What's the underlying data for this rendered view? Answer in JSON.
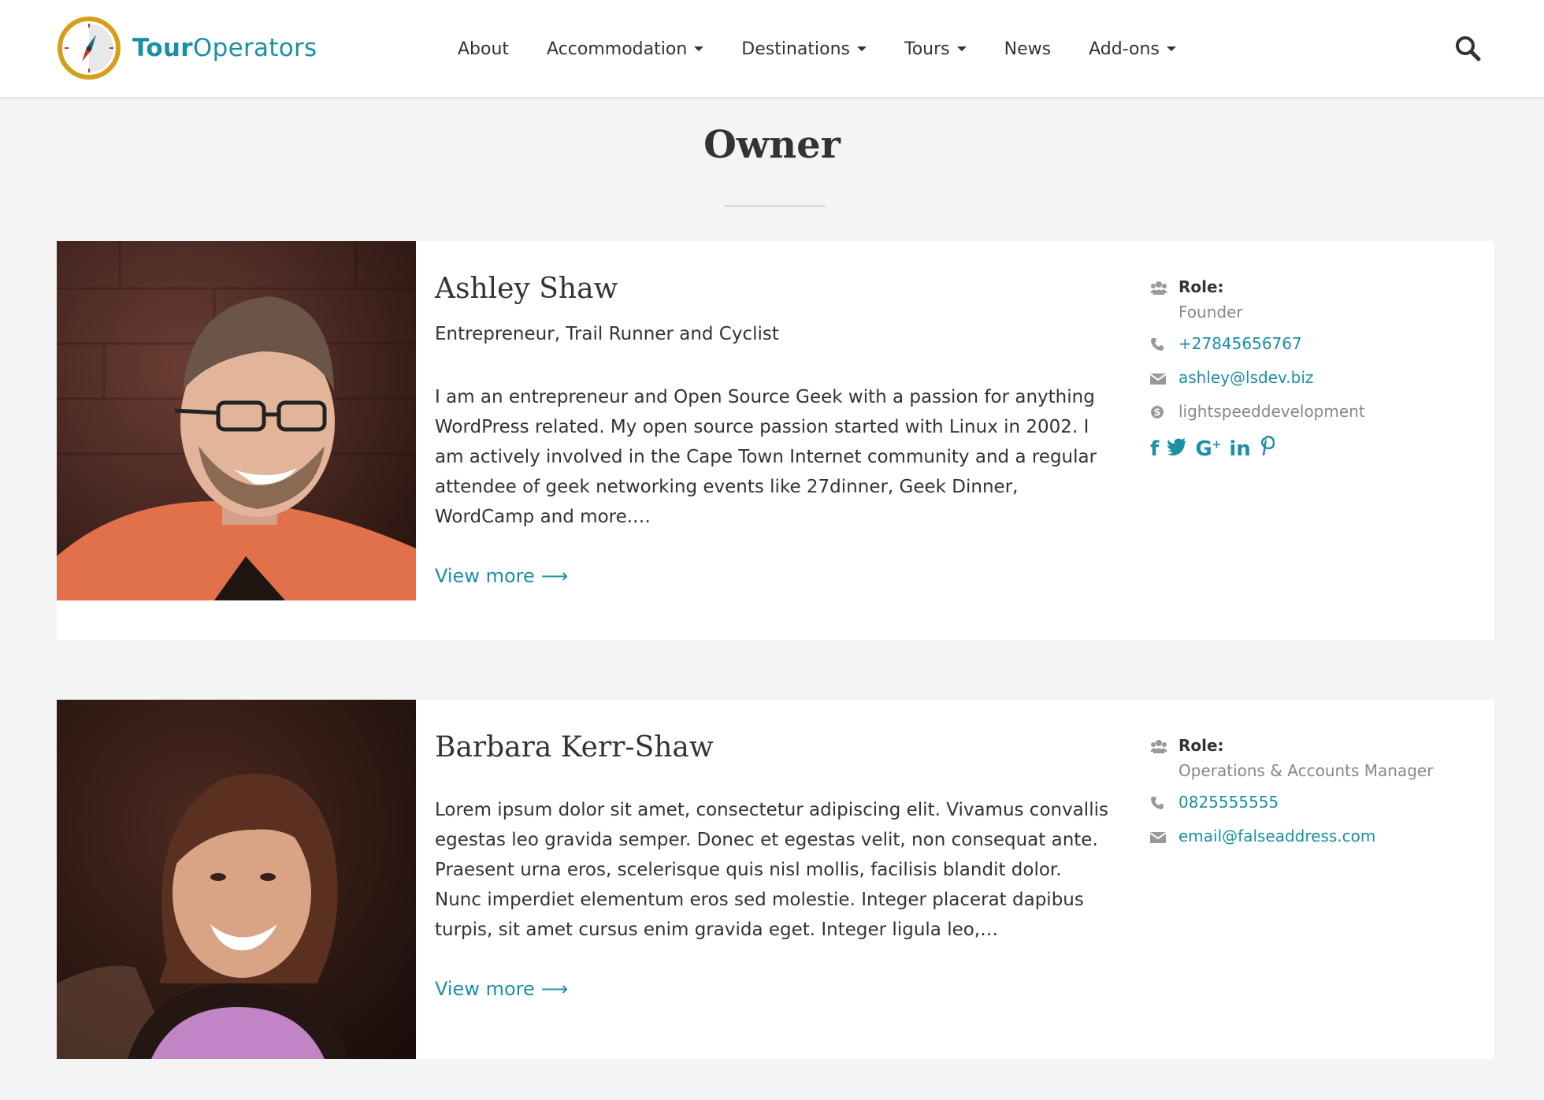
{
  "brand": {
    "part1": "Tour",
    "part2": "Operators",
    "color": "#1b8fa6",
    "mark_color": "#d4a017"
  },
  "nav": {
    "items": [
      {
        "label": "About",
        "dropdown": false
      },
      {
        "label": "Accommodation",
        "dropdown": true
      },
      {
        "label": "Destinations",
        "dropdown": true
      },
      {
        "label": "Tours",
        "dropdown": true
      },
      {
        "label": "News",
        "dropdown": false
      },
      {
        "label": "Add-ons",
        "dropdown": true
      }
    ],
    "search_icon": "search-icon"
  },
  "page": {
    "title": "Owner"
  },
  "people": [
    {
      "name": "Ashley Shaw",
      "tagline": "Entrepreneur, Trail Runner and Cyclist",
      "bio": "I am an entrepreneur and Open Source Geek with a passion for anything WordPress related. My open source passion started with Linux in 2002. I am actively involved in the Cape Town Internet community and a regular attendee of geek networking events like 27dinner, Geek Dinner, WordCamp and more.…",
      "view_more": "View more",
      "role_label": "Role:",
      "role": "Founder",
      "phone": "+27845656767",
      "email": "ashley@lsdev.biz",
      "skype": "lightspeeddevelopment",
      "social": [
        "facebook-icon",
        "twitter-icon",
        "google-plus-icon",
        "linkedin-icon",
        "pinterest-icon"
      ]
    },
    {
      "name": "Barbara Kerr-Shaw",
      "bio": "Lorem ipsum dolor sit amet, consectetur adipiscing elit. Vivamus convallis egestas leo gravida semper. Donec et egestas velit, non consequat ante. Praesent urna eros, scelerisque quis nisl mollis, facilisis blandit dolor. Nunc imperdiet elementum eros sed molestie. Integer placerat dapibus turpis, sit amet cursus enim gravida eget. Integer ligula leo,…",
      "view_more": "View more",
      "role_label": "Role:",
      "role": "Operations & Accounts Manager",
      "phone": "0825555555",
      "email": "email@falseaddress.com"
    }
  ]
}
